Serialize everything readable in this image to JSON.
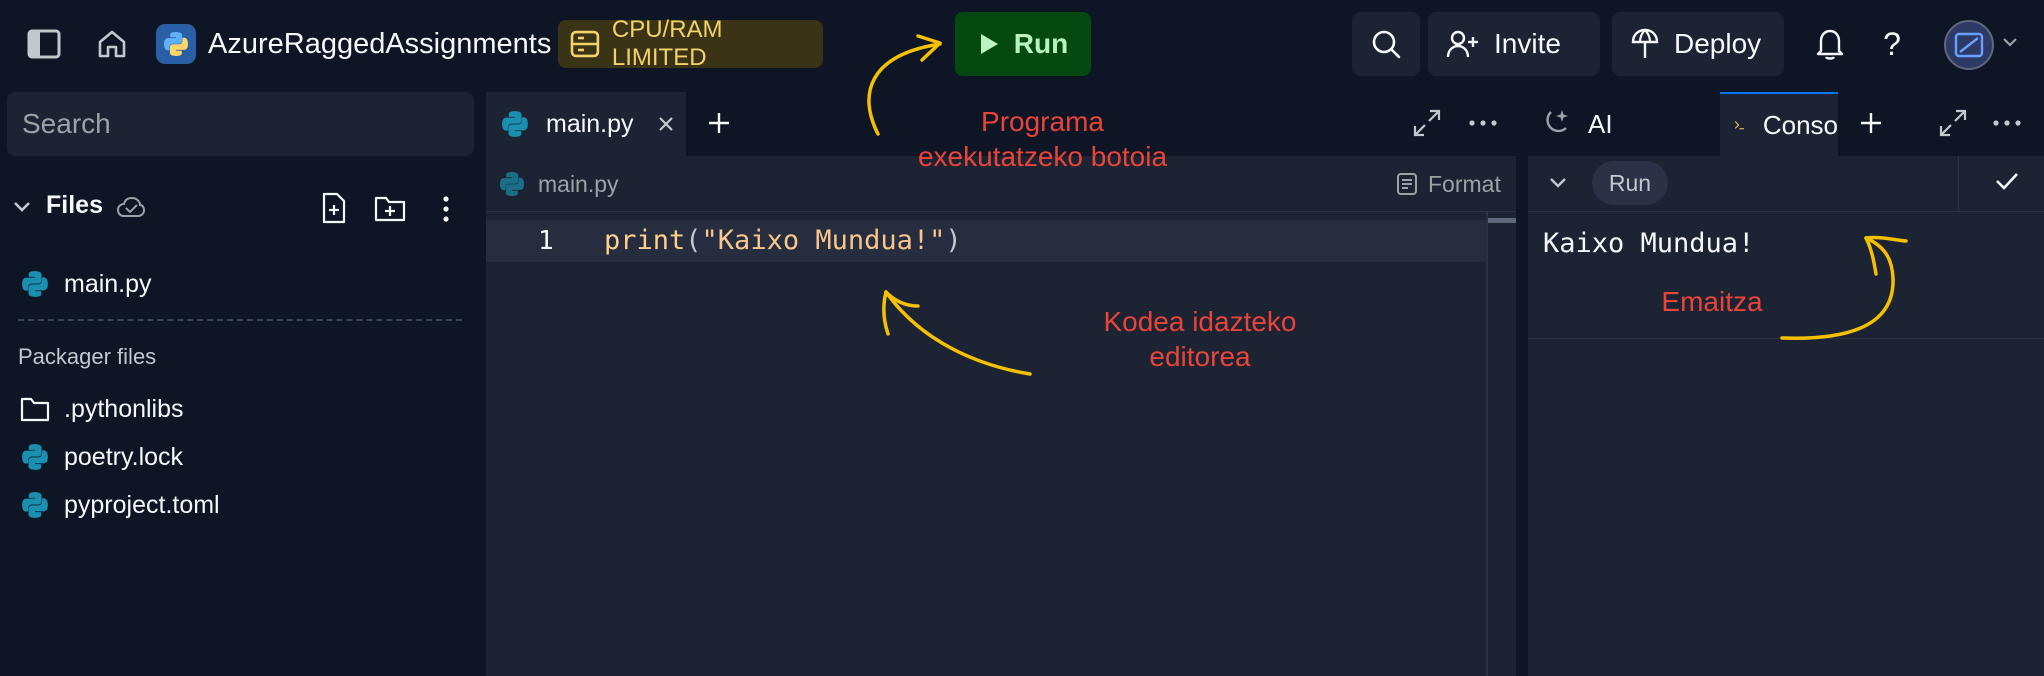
{
  "header": {
    "project_name": "AzureRaggedAssignments",
    "limit_badge": "CPU/RAM LIMITED",
    "run_label": "Run",
    "invite_label": "Invite",
    "deploy_label": "Deploy",
    "help_label": "?"
  },
  "sidebar": {
    "search_placeholder": "Search",
    "files_title": "Files",
    "files": [
      {
        "name": "main.py",
        "icon": "python-icon"
      }
    ],
    "packager_title": "Packager files",
    "packager_files": [
      {
        "name": ".pythonlibs",
        "icon": "folder-icon"
      },
      {
        "name": "poetry.lock",
        "icon": "python-icon"
      },
      {
        "name": "pyproject.toml",
        "icon": "python-icon"
      }
    ]
  },
  "editor": {
    "tab_label": "main.py",
    "breadcrumb": "main.py",
    "format_label": "Format",
    "lines": [
      {
        "number": "1",
        "fn": "print",
        "open": "(",
        "string": "\"Kaixo Mundua!\"",
        "close": ")"
      }
    ]
  },
  "right_panel": {
    "tabs": [
      {
        "label": "AI",
        "icon": "ai-icon"
      },
      {
        "label": "Conso",
        "icon": "console-icon",
        "active": true
      }
    ],
    "run_chip": "Run",
    "output": "Kaixo Mundua!"
  },
  "annotations": {
    "run_button_note_line1": "Programa",
    "run_button_note_line2": "exekutatzeko botoia",
    "editor_note_line1": "Kodea idazteko",
    "editor_note_line2": "editorea",
    "output_note": "Emaitza",
    "color_text": "#e8443a",
    "color_arrow": "#f5c000"
  }
}
